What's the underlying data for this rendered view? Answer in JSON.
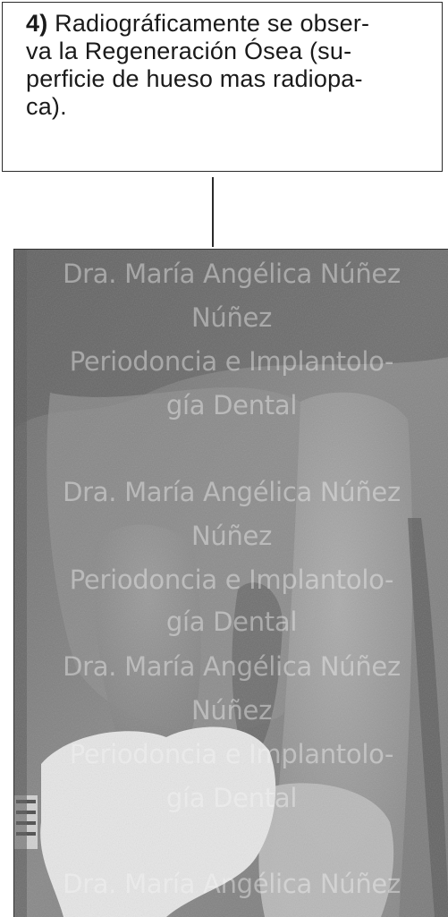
{
  "caption": {
    "number": "4)",
    "lines": [
      "Radiográficamente se obser-",
      "va la Regeneración Ósea (su-",
      "perficie de hueso mas radiopa-",
      "ca)."
    ]
  },
  "watermark": {
    "line1": "Dra. María Angélica Núñez",
    "line2": "Núñez",
    "line3": "Periodoncia e Implantolo-",
    "line4": "gía Dental"
  },
  "image": {
    "subject": "dental-radiograph",
    "accent_restoration_color": "#e6e6e6"
  }
}
